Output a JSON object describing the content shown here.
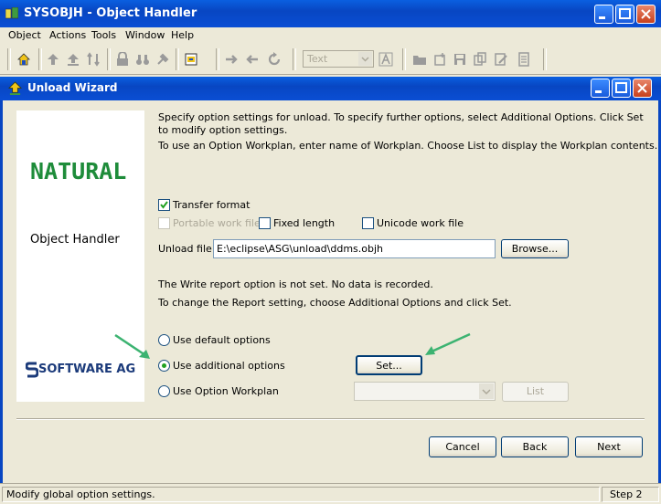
{
  "app": {
    "title": "SYSOBJH - Object Handler",
    "menu": [
      "Object",
      "Actions",
      "Tools",
      "Window",
      "Help"
    ],
    "font_combo": "Text"
  },
  "wizard": {
    "title": "Unload Wizard",
    "logo_text": "NATURAL",
    "product_label": "Object Handler",
    "vendor_logo": "SOFTWARE AG",
    "intro1": "Specify option settings for unload. To specify further options, select Additional Options. Click Set to modify option settings.",
    "intro2": "To use an Option Workplan, enter name of Workplan. Choose List to display the  Workplan contents.",
    "transfer_format": "Transfer format",
    "portable": "Portable work file",
    "fixed_length": "Fixed length",
    "unicode": "Unicode work file",
    "unload_file_label": "Unload file:",
    "unload_file_value": "E:\\eclipse\\ASG\\unload\\ddms.objh",
    "browse": "Browse...",
    "report1": "The Write report option is not set. No data is recorded.",
    "report2": "To change the Report setting, choose Additional Options and click Set.",
    "opt_default": "Use default options",
    "opt_additional": "Use additional options",
    "opt_workplan": "Use Option Workplan",
    "set": "Set...",
    "list": "List",
    "cancel": "Cancel",
    "back": "Back",
    "next": "Next"
  },
  "status": {
    "message": "Modify global option settings.",
    "step": "Step 2"
  },
  "colors": {
    "titlebar": "#0846c2",
    "logo_green": "#1e8c3a",
    "arrow": "#3cb371"
  }
}
